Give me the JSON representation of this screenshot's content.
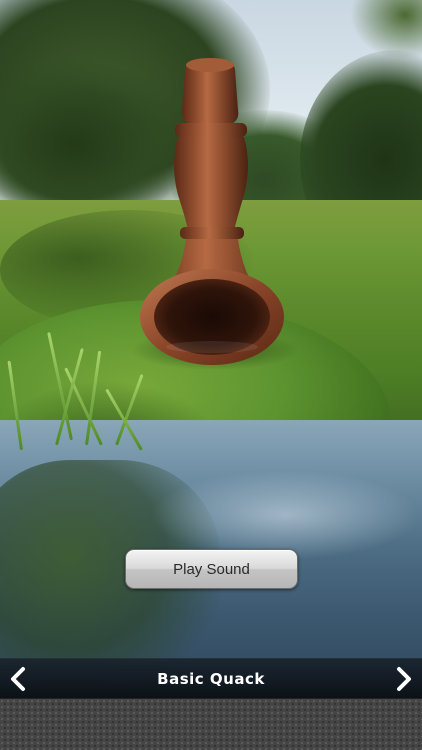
{
  "scene": {
    "description_icon": "duck-call-icon"
  },
  "play_button": {
    "label": "Play Sound"
  },
  "nav": {
    "title": "Basic Quack",
    "prev_icon": "chevron-left-icon",
    "next_icon": "chevron-right-icon"
  },
  "colors": {
    "nav_bg": "#111820",
    "nav_text": "#ffffff",
    "button_bg": "#d0d0d0",
    "button_text": "#2a2a2a",
    "footer_bg": "#454545",
    "duck_call_wood": "#8a4a2e"
  }
}
